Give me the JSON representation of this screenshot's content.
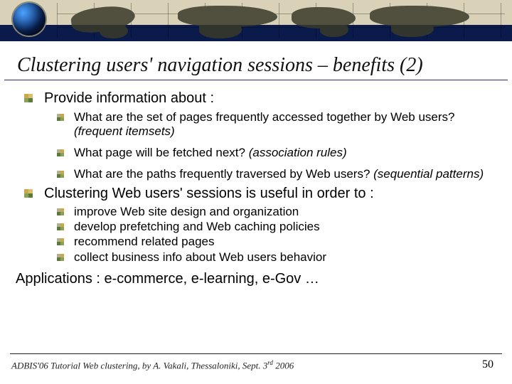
{
  "title": "Clustering users' navigation sessions – benefits (2)",
  "b1a": "Provide information about :",
  "b2a_text": "What are the set of pages frequently accessed together by Web users?   ",
  "b2a_em": "(frequent itemsets)",
  "b2b_text": "What page will be fetched next? ",
  "b2b_em": "(association rules)",
  "b2c_text": "What are the paths frequently traversed by Web users? ",
  "b2c_em": "(sequential patterns)",
  "b1b": "Clustering Web users' sessions is useful in order to :",
  "u1": "improve Web site design and organization",
  "u2": "develop prefetching and Web caching policies",
  "u3": "recommend related pages",
  "u4": "collect business info about Web users behavior",
  "apps": "Applications : e-commerce, e-learning, e-Gov …",
  "footer_pre": "ADBIS'06 Tutorial Web clustering, by A. Vakali, Thessaloniki, Sept. 3",
  "footer_sup": "rd",
  "footer_post": " 2006",
  "page": "50"
}
